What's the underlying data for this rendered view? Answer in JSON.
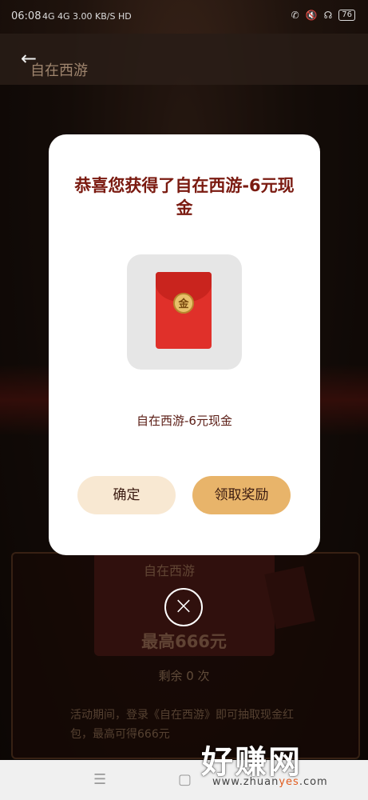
{
  "status_bar": {
    "time": "06:08",
    "network": "4G 4G 3.00 KB/S HD",
    "battery": "76"
  },
  "header": {
    "app_logo_text": "自在西游"
  },
  "background": {
    "logo_text": "自在西游",
    "max_text": "最高666元",
    "remaining_text": "剩余 0 次",
    "description": "活动期间，登录《自在西游》即可抽取现金红包，最高可得666元"
  },
  "dialog": {
    "title": "恭喜您获得了自在西游-6元现金",
    "coin_char": "金",
    "prize_name": "自在西游-6元现金",
    "confirm_label": "确定",
    "claim_label": "领取奖励"
  },
  "close_icon": "close-icon",
  "watermark": {
    "big_text": "好赚网",
    "url_prefix": "www.zhuan",
    "url_highlight": "yes",
    "url_suffix": ".com"
  },
  "colors": {
    "title": "#7a1a10",
    "confirm_bg": "#f8e8d2",
    "claim_bg": "#e8b46a",
    "envelope": "#e0302a"
  }
}
